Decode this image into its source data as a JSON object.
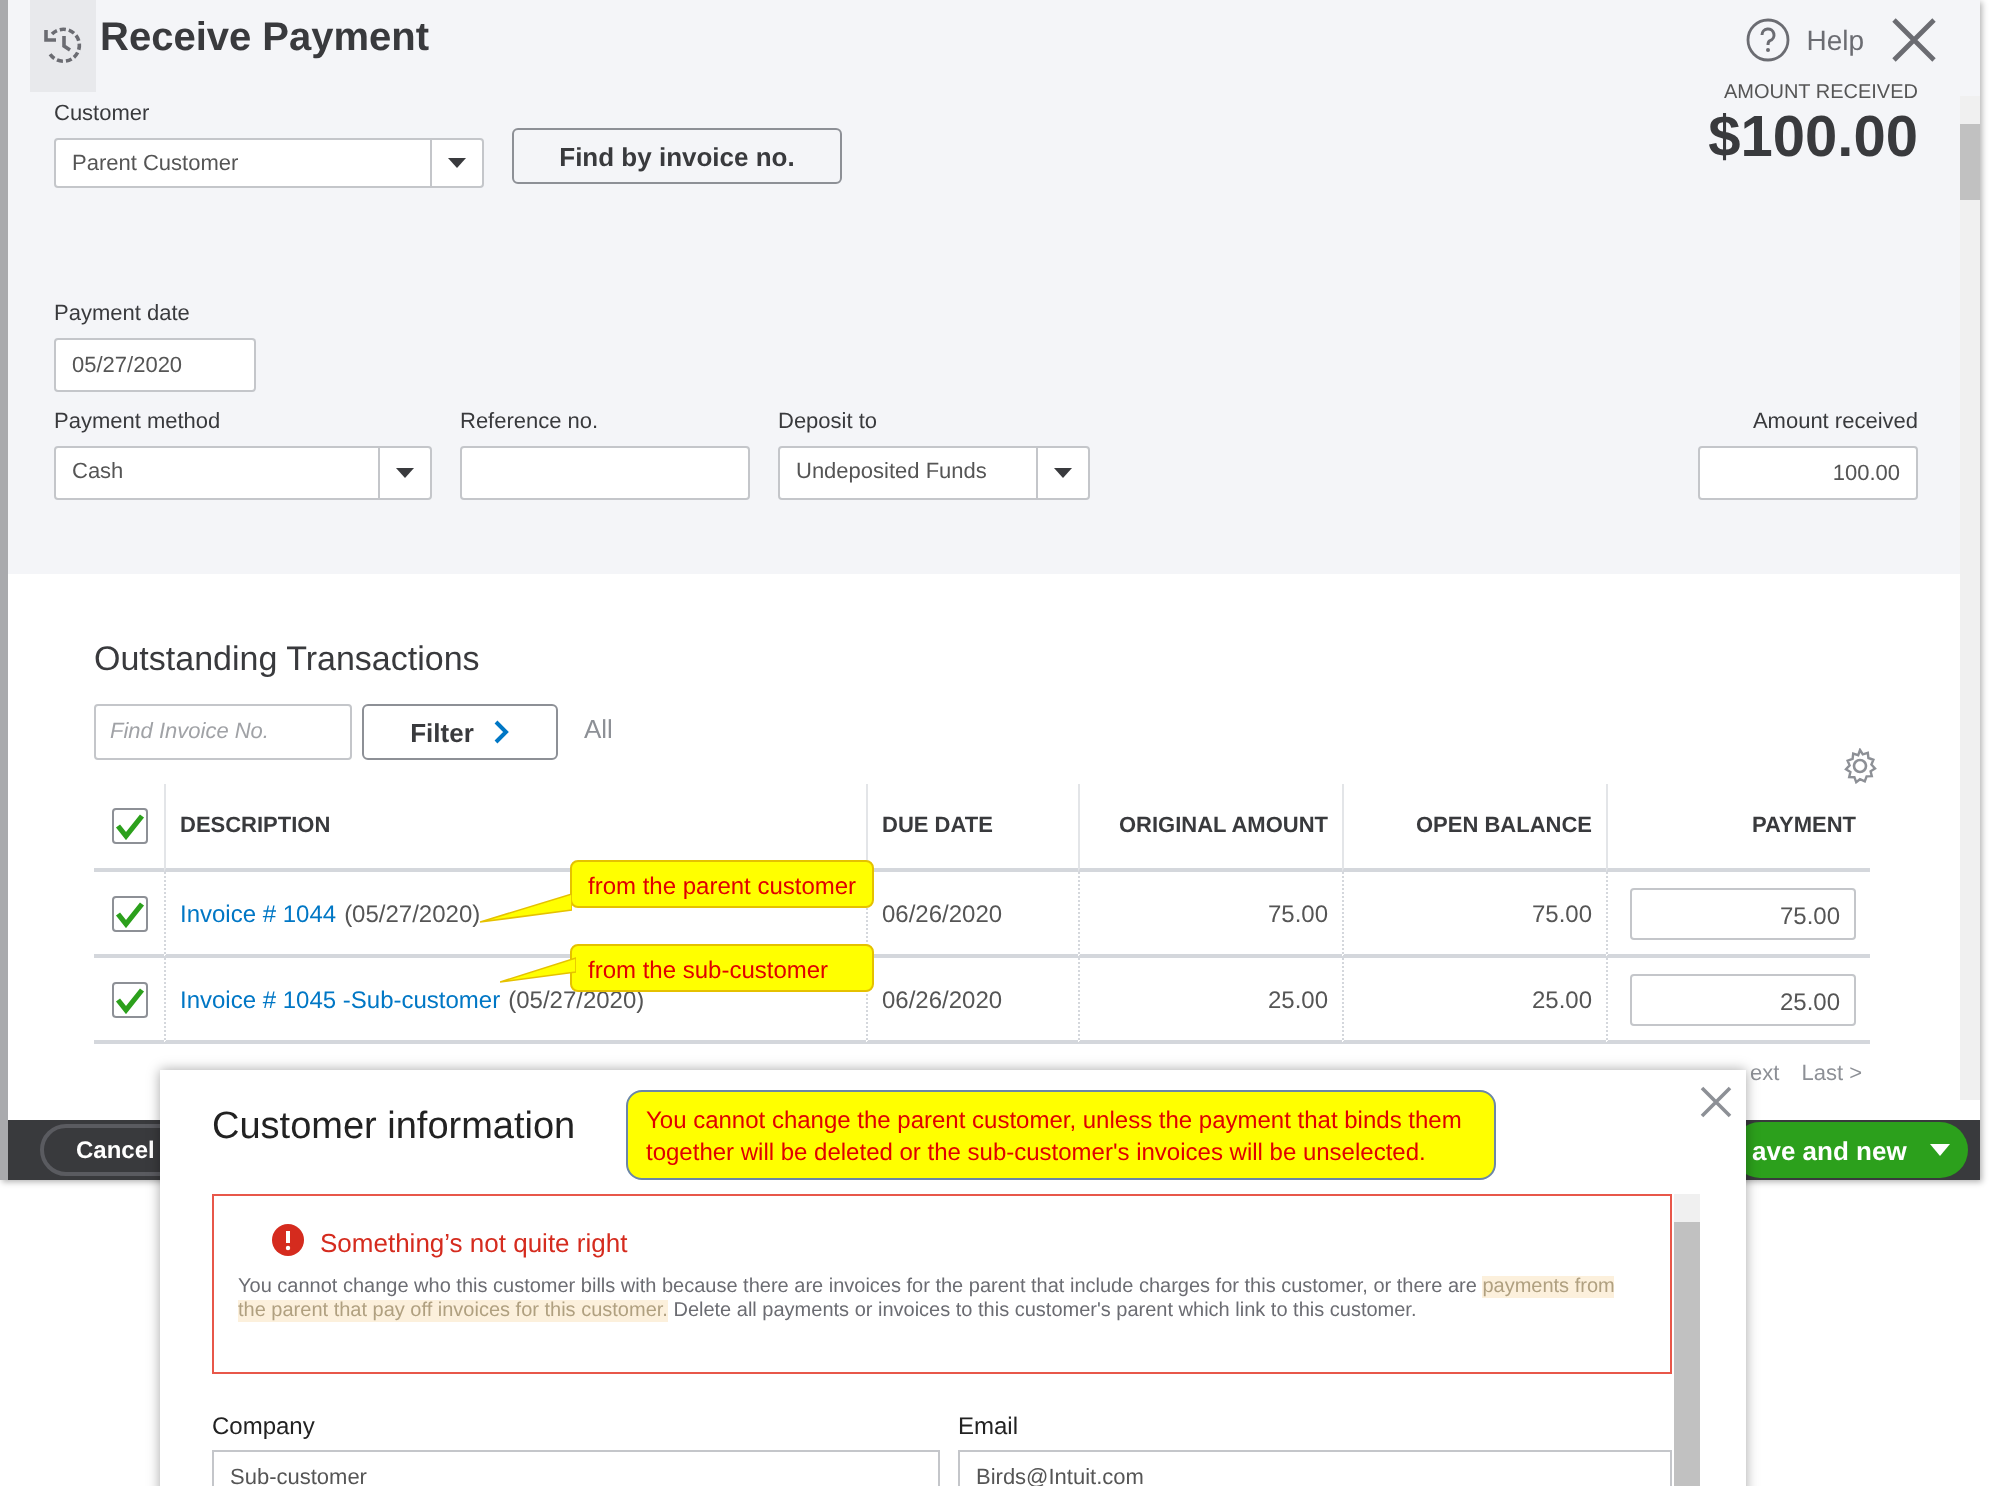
{
  "window": {
    "title": "Receive Payment",
    "help": "Help"
  },
  "amount_header": {
    "label": "AMOUNT RECEIVED",
    "amount": "$100.00"
  },
  "customer": {
    "label": "Customer",
    "value": "Parent Customer"
  },
  "find_button": "Find by invoice no.",
  "payment_date": {
    "label": "Payment date",
    "value": "05/27/2020"
  },
  "payment_method": {
    "label": "Payment method",
    "value": "Cash"
  },
  "reference": {
    "label": "Reference no."
  },
  "deposit_to": {
    "label": "Deposit to",
    "value": "Undeposited Funds"
  },
  "amount_received": {
    "label": "Amount received",
    "value": "100.00"
  },
  "outstanding": {
    "title": "Outstanding Transactions",
    "search": {
      "placeholder": "Find Invoice No."
    },
    "filter": "Filter",
    "filter_value": "All",
    "table": {
      "all_checked": true,
      "columns": [
        "DESCRIPTION",
        "DUE DATE",
        "ORIGINAL AMOUNT",
        "OPEN BALANCE",
        "PAYMENT"
      ],
      "rows": [
        {
          "checked": true,
          "invoice": "Invoice # 1044",
          "date": "(05/27/2020)",
          "due_date": "06/26/2020",
          "original": "75.00",
          "open": "75.00",
          "payment": "75.00"
        },
        {
          "checked": true,
          "invoice": "Invoice # 1045 -Sub-customer",
          "date": "(05/27/2020)",
          "due_date": "06/26/2020",
          "original": "25.00",
          "open": "25.00",
          "payment": "25.00"
        }
      ]
    },
    "pager": [
      "ext",
      "Last >"
    ]
  },
  "callouts": [
    "from the parent customer",
    "from the sub-customer"
  ],
  "footer": {
    "cancel": "Cancel",
    "save": "ave and new"
  },
  "dialog": {
    "title": "Customer information",
    "note": "You cannot change the parent customer, unless the payment that binds them together will be deleted or the sub-customer's invoices will be unselected.",
    "error": {
      "title": "Something’s not quite right",
      "text_before": "You cannot change who this customer bills with because there are invoices for the parent that include charges for this customer, or there are ",
      "text_highlight": "payments from the parent that pay off invoices for this customer.",
      "text_after": " Delete all payments or invoices to this customer's parent which link to this customer."
    },
    "company": {
      "label": "Company",
      "value": "Sub-customer"
    },
    "email": {
      "label": "Email",
      "value": "Birds@Intuit.com"
    }
  }
}
